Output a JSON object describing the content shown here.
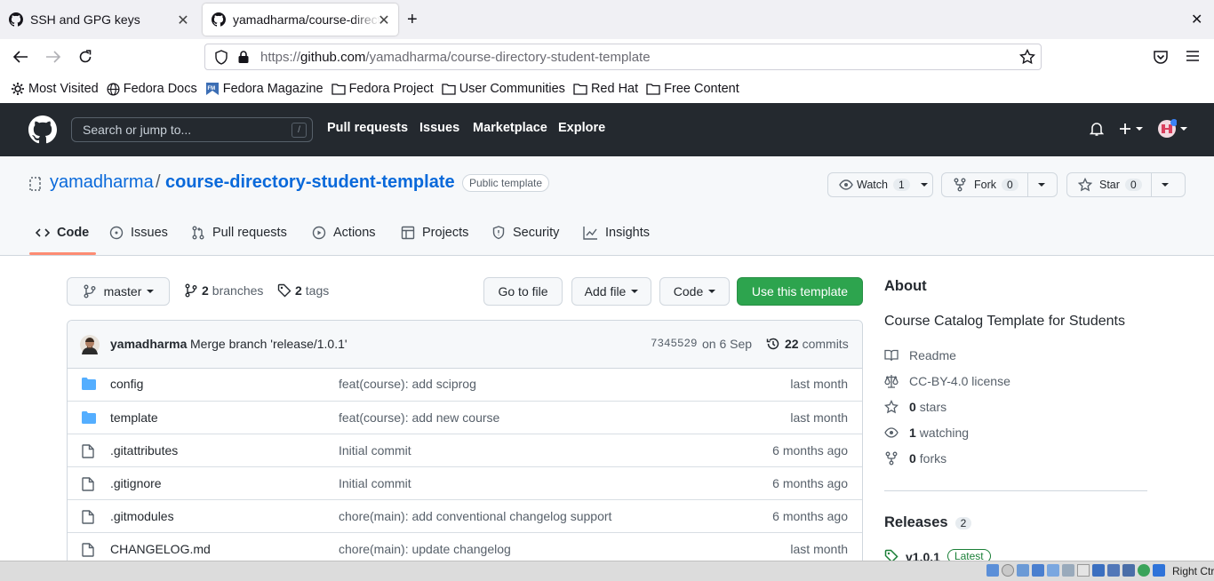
{
  "browser": {
    "tabs": [
      {
        "title": "SSH and GPG keys"
      },
      {
        "title": "yamadharma/course-directory-student-template"
      }
    ],
    "url_prefix": "https://",
    "url_domain": "github.com",
    "url_path": "/yamadharma/course-directory-student-template",
    "bookmarks": [
      "Most Visited",
      "Fedora Docs",
      "Fedora Magazine",
      "Fedora Project",
      "User Communities",
      "Red Hat",
      "Free Content"
    ]
  },
  "github": {
    "search_placeholder": "Search or jump to...",
    "search_shortcut": "/",
    "nav": [
      "Pull requests",
      "Issues",
      "Marketplace",
      "Explore"
    ]
  },
  "repo": {
    "owner": "yamadharma",
    "separator": "/",
    "name": "course-directory-student-template",
    "visibility": "Public template",
    "watch_label": "Watch",
    "watch_count": "1",
    "fork_label": "Fork",
    "fork_count": "0",
    "star_label": "Star",
    "star_count": "0",
    "tabs": [
      "Code",
      "Issues",
      "Pull requests",
      "Actions",
      "Projects",
      "Security",
      "Insights"
    ]
  },
  "toolbar": {
    "branch": "master",
    "branches_count": "2",
    "branches_label": "branches",
    "tags_count": "2",
    "tags_label": "tags",
    "go_to_file": "Go to file",
    "add_file": "Add file",
    "code": "Code",
    "use_template": "Use this template"
  },
  "commit": {
    "author": "yamadharma",
    "message": "Merge branch 'release/1.0.1'",
    "sha": "7345529",
    "date": "on 6 Sep",
    "count": "22",
    "count_label": "commits"
  },
  "files": [
    {
      "name": "config",
      "type": "dir",
      "message": "feat(course): add sciprog",
      "age": "last month"
    },
    {
      "name": "template",
      "type": "dir",
      "message": "feat(course): add new course",
      "age": "last month"
    },
    {
      "name": ".gitattributes",
      "type": "file",
      "message": "Initial commit",
      "age": "6 months ago"
    },
    {
      "name": ".gitignore",
      "type": "file",
      "message": "Initial commit",
      "age": "6 months ago"
    },
    {
      "name": ".gitmodules",
      "type": "file",
      "message": "chore(main): add conventional changelog support",
      "age": "6 months ago"
    },
    {
      "name": "CHANGELOG.md",
      "type": "file",
      "message": "chore(main): update changelog",
      "age": "last month"
    }
  ],
  "about": {
    "heading": "About",
    "description": "Course Catalog Template for Students",
    "readme": "Readme",
    "license": "CC-BY-4.0 license",
    "stars_count": "0",
    "stars_label": "stars",
    "watching_count": "1",
    "watching_label": "watching",
    "forks_count": "0",
    "forks_label": "forks"
  },
  "releases": {
    "heading": "Releases",
    "count": "2",
    "latest_tag": "v1.0.1",
    "latest_badge": "Latest"
  },
  "taskbar": {
    "right_ctrl": "Right Ctrl"
  },
  "colors": {
    "github_header": "#24292f",
    "link": "#0969da",
    "primary_button": "#2da44e",
    "folder": "#54aeff",
    "tab_underline": "#fd8c73"
  }
}
